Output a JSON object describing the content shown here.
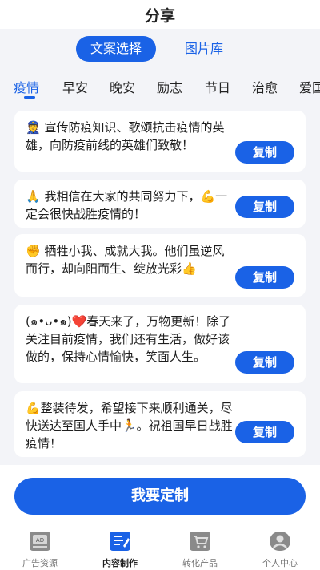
{
  "header": {
    "title": "分享"
  },
  "segment": {
    "active": "文案选择",
    "inactive": "图片库"
  },
  "tabs": [
    "疫情",
    "早安",
    "晚安",
    "励志",
    "节日",
    "治愈",
    "爱国"
  ],
  "cards": [
    {
      "text": "👮 宣传防疫知识、歌颂抗击疫情的英雄，向防疫前线的英雄们致敬！",
      "button": "复制"
    },
    {
      "text": "🙏 我相信在大家的共同努力下，💪一定会很快战胜疫情的！",
      "button": "复制"
    },
    {
      "text": "✊ 牺牲小我、成就大我。他们虽逆风而行，却向阳而生、绽放光彩👍",
      "button": "复制"
    },
    {
      "text": "(๑•ᴗ•๑)❤️春天来了，万物更新！除了关注目前疫情，我们还有生活，做好该做的，保持心情愉快，笑面人生。",
      "button": "复制"
    },
    {
      "text": "💪整装待发，希望接下来顺利通关，尽快送达至国人手中🏃。祝祖国早日战胜疫情！",
      "button": "复制"
    }
  ],
  "cta": {
    "label": "我要定制"
  },
  "nav": [
    {
      "label": "广告资源",
      "icon": "ad-icon"
    },
    {
      "label": "内容制作",
      "icon": "edit-document-icon"
    },
    {
      "label": "转化产品",
      "icon": "cart-icon"
    },
    {
      "label": "个人中心",
      "icon": "user-icon"
    }
  ],
  "colors": {
    "accent": "#1a62e6",
    "background": "#f3f4f8"
  }
}
